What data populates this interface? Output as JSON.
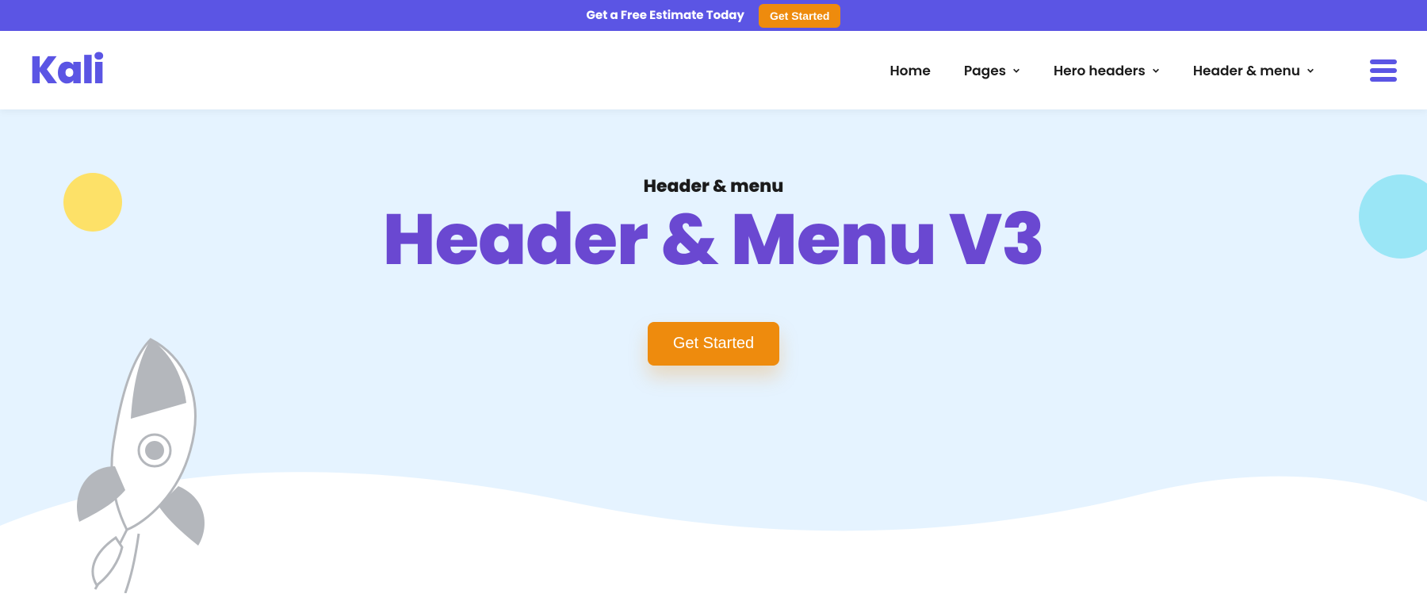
{
  "promo": {
    "text": "Get a Free Estimate Today",
    "button": "Get Started"
  },
  "brand": {
    "name": "Kali"
  },
  "nav": {
    "items": [
      {
        "label": "Home",
        "has_submenu": false
      },
      {
        "label": "Pages",
        "has_submenu": true
      },
      {
        "label": "Hero headers",
        "has_submenu": true
      },
      {
        "label": "Header & menu",
        "has_submenu": true
      }
    ]
  },
  "hero": {
    "eyebrow": "Header & menu",
    "title": "Header & Menu V3",
    "cta_label": "Get Started"
  },
  "colors": {
    "primary": "#5b55e4",
    "title": "#6a48d1",
    "accent": "#ee8b0d",
    "hero_bg": "#e5f3ff",
    "circle_yellow": "#fde168",
    "circle_cyan": "#9ae6f6"
  }
}
